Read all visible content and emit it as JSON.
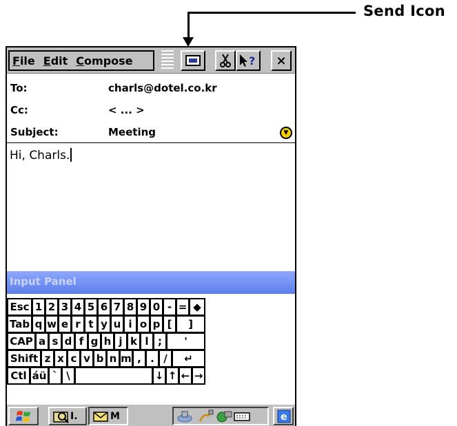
{
  "annotation": {
    "text": "Send Icon"
  },
  "menu": {
    "file": "File",
    "edit": "Edit",
    "compose": "Compose"
  },
  "toolbar": {
    "send_icon": "send-icon",
    "cut_icon": "cut-icon",
    "help_icon": "help-icon",
    "close_glyph": "×"
  },
  "header": {
    "to_label": "To:",
    "to_value": "charls@dotel.co.kr",
    "cc_label": "Cc:",
    "cc_value": "< ... >",
    "subject_label": "Subject:",
    "subject_value": "Meeting"
  },
  "body": {
    "text": "Hi, Charls."
  },
  "input_panel": {
    "title": "Input Panel"
  },
  "keyboard": {
    "rows": [
      [
        "Esc",
        "1",
        "2",
        "3",
        "4",
        "5",
        "6",
        "7",
        "8",
        "9",
        "0",
        "-",
        "=",
        "◆"
      ],
      [
        "Tab",
        "q",
        "w",
        "e",
        "r",
        "t",
        "y",
        "u",
        "i",
        "o",
        "p",
        "[",
        "]"
      ],
      [
        "CAP",
        "a",
        "s",
        "d",
        "f",
        "g",
        "h",
        "j",
        "k",
        "l",
        ";",
        "'"
      ],
      [
        "Shift",
        "z",
        "x",
        "c",
        "v",
        "b",
        "n",
        "m",
        ",",
        ".",
        "/",
        "↵"
      ],
      [
        "Ctl",
        "áü",
        "`",
        "\\",
        "",
        "↓",
        "↑",
        "←",
        "→"
      ]
    ]
  },
  "taskbar": {
    "app1": "I.",
    "app2": "M"
  }
}
